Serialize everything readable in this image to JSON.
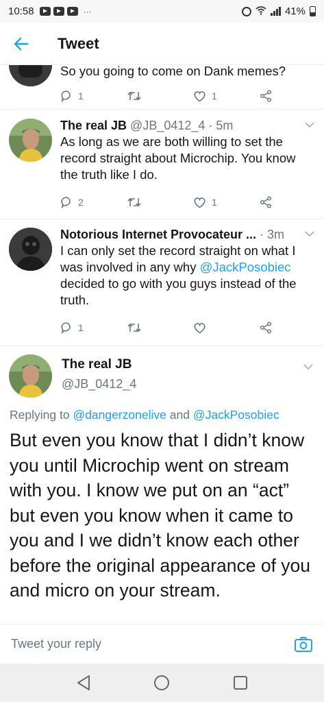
{
  "status_bar": {
    "time": "10:58",
    "dots": "···",
    "battery": "41%"
  },
  "header": {
    "title": "Tweet"
  },
  "tweets": [
    {
      "text": "So you going to come on Dank memes?",
      "replies": "1",
      "retweets": "",
      "likes": "1"
    },
    {
      "name": "The real JB",
      "handle": "@JB_0412_4 · 5m",
      "text": "As long as we are both willing to set the record straight about Microchip. You know the truth like I do.",
      "replies": "2",
      "retweets": "",
      "likes": "1"
    },
    {
      "name": "Notorious Internet Provocateur ...",
      "handle": "· 3m",
      "text_before": "I can only set the record straight on what I was involved in any why ",
      "mention": "@JackPosobiec",
      "text_after": " decided to go with you guys instead of the truth.",
      "replies": "1",
      "retweets": "",
      "likes": ""
    }
  ],
  "main_tweet": {
    "name": "The real JB",
    "handle": "@JB_0412_4",
    "replying_prefix": "Replying to ",
    "replying_user1": "@dangerzonelive",
    "replying_and": " and ",
    "replying_user2": "@JackPosobiec",
    "text": "But even you know that I didn’t know you until Microchip went on stream with you. I know we put on an “act” but even you know when it came to you and I we didn’t know each other before the original appearance of you and micro on your stream."
  },
  "reply_bar": {
    "placeholder": "Tweet your reply"
  },
  "colors": {
    "accent": "#1da1f2",
    "muted": "#657786"
  }
}
